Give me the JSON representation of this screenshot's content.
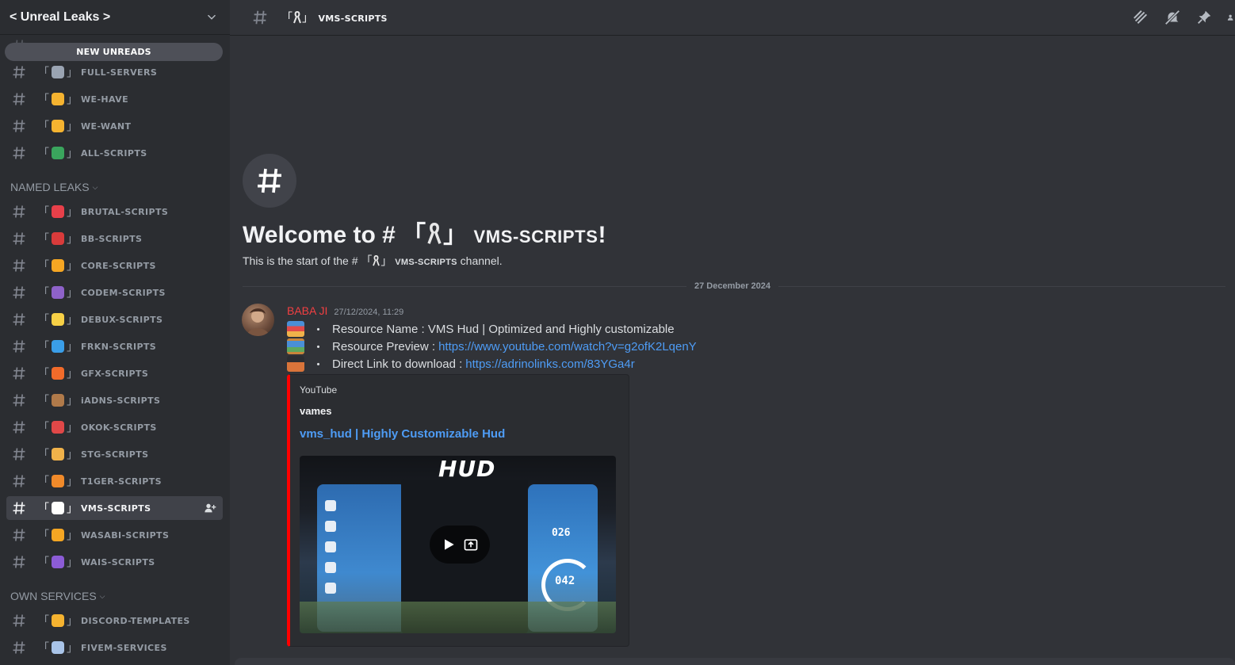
{
  "server": {
    "name": "< Unreal Leaks >"
  },
  "new_unreads_label": "NEW UNREADS",
  "sidebar": {
    "top_channels": [
      {
        "name": "FULL-SERVERS",
        "emoji": "ufo",
        "color": "#9aa4b2"
      },
      {
        "name": "WE-HAVE",
        "emoji": "raised-hand",
        "color": "#f5b330"
      },
      {
        "name": "WE-WANT",
        "emoji": "pointing-hand",
        "color": "#f5b330"
      },
      {
        "name": "ALL-SCRIPTS",
        "emoji": "books",
        "color": "#3aa55d"
      }
    ],
    "categories": [
      {
        "label": "NAMED LEAKS",
        "channels": [
          {
            "name": "BRUTAL-SCRIPTS",
            "emoji": "siren",
            "color": "#e8404a"
          },
          {
            "name": "BB-SCRIPTS",
            "emoji": "lobster",
            "color": "#d93b3b"
          },
          {
            "name": "CORE-SCRIPTS",
            "emoji": "sun",
            "color": "#f5a623"
          },
          {
            "name": "CODEM-SCRIPTS",
            "emoji": "bomb",
            "color": "#8e62c9"
          },
          {
            "name": "DEBUX-SCRIPTS",
            "emoji": "light-bulb",
            "color": "#f7d046"
          },
          {
            "name": "FRKN-SCRIPTS",
            "emoji": "wave",
            "color": "#3a9ee8"
          },
          {
            "name": "GFX-SCRIPTS",
            "emoji": "fire",
            "color": "#f26b2a"
          },
          {
            "name": "iADNS-SCRIPTS",
            "emoji": "snail",
            "color": "#b07a4a"
          },
          {
            "name": "OKOK-SCRIPTS",
            "emoji": "round-pushpin",
            "color": "#e04848"
          },
          {
            "name": "STG-SCRIPTS",
            "emoji": "beer",
            "color": "#f0b24a"
          },
          {
            "name": "T1GER-SCRIPTS",
            "emoji": "tiger",
            "color": "#f08a2a"
          },
          {
            "name": "VMS-SCRIPTS",
            "emoji": "ribbon",
            "color": "#ffffff",
            "active": true
          },
          {
            "name": "WASABI-SCRIPTS",
            "emoji": "zap",
            "color": "#f5a623"
          },
          {
            "name": "WAIS-SCRIPTS",
            "emoji": "purple-sign",
            "color": "#8c5cd6"
          }
        ]
      },
      {
        "label": "OWN SERVICES",
        "channels": [
          {
            "name": "DISCORD-TEMPLATES",
            "emoji": "writing-hand",
            "color": "#f5b330"
          },
          {
            "name": "FIVEM-SERVICES",
            "emoji": "syringe",
            "color": "#a9c4e8"
          }
        ]
      }
    ]
  },
  "channel": {
    "bracket_open": "「",
    "bracket_close": "」",
    "name": "vms-scripts",
    "topbar_name": "vms-scripts"
  },
  "welcome": {
    "prefix": "Welcome to # 「",
    "channel": "vms-scripts",
    "suffix": "!",
    "bracket_close": "」",
    "sub_prefix": "This is the start of the # 「",
    "sub_bracket_close": "」",
    "sub_channel": "vms-scripts",
    "sub_suffix": " channel."
  },
  "date_divider": "27 December 2024",
  "message": {
    "author": "BABA JI",
    "author_color": "#f23f42",
    "timestamp": "27/12/2024, 11:29",
    "lines": [
      {
        "emoji": "books",
        "label": "Resource Name : VMS Hud | Optimized and Highly customizable",
        "link": ""
      },
      {
        "emoji": "framed-picture",
        "label": "Resource Preview :",
        "link": "https://www.youtube.com/watch?v=g2ofK2LqenY"
      },
      {
        "emoji": "inbox-tray",
        "label": "Direct Link to download :",
        "link": "https://adrinolinks.com/83YGa4r"
      }
    ],
    "embed": {
      "provider": "YouTube",
      "author": "vames",
      "title": "vms_hud | Highly Customizable Hud",
      "thumbnail_text": "HUD",
      "speed_top": "026",
      "speed_gauge": "042",
      "accent": "#ff0000"
    }
  }
}
